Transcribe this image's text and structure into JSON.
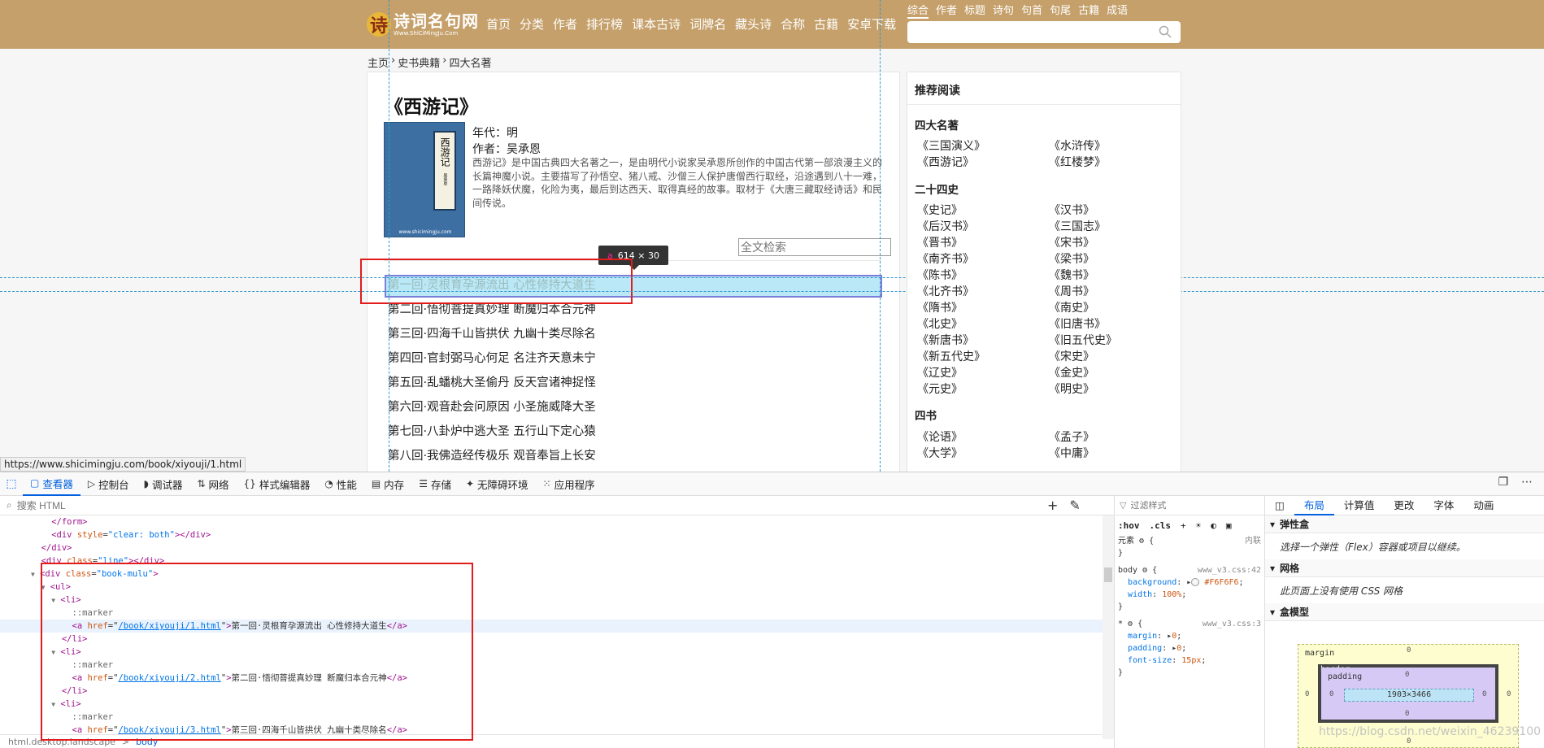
{
  "site": {
    "logo": {
      "title": "诗词名句网",
      "sub": "Www.ShiCiMingJu.Com"
    },
    "nav": [
      "首页",
      "分类",
      "作者",
      "排行榜",
      "课本古诗",
      "词牌名",
      "藏头诗",
      "合称",
      "古籍",
      "安卓下载"
    ],
    "search_tabs": [
      "综合",
      "作者",
      "标题",
      "诗句",
      "句首",
      "句尾",
      "古籍",
      "成语"
    ],
    "breadcrumb": [
      "主页",
      "›",
      "史书典籍",
      "›",
      "四大名著"
    ],
    "book": {
      "title": "《西游记》",
      "cover_text": "西游记",
      "cover_small": "吴承恩",
      "cover_url": "www.shicimingju.com",
      "era": "年代：明",
      "author": "作者：吴承恩",
      "desc": "西游记》是中国古典四大名著之一，是由明代小说家吴承恩所创作的中国古代第一部浪漫主义的长篇神魔小说。主要描写了孙悟空、猪八戒、沙僧三人保护唐僧西行取经，沿途遇到八十一难，一路降妖伏魔，化险为夷，最后到达西天、取得真经的故事。取材于《大唐三藏取经诗话》和民间传说。"
    },
    "fulltext_placeholder": "全文检索",
    "chapters": [
      "第一回·灵根育孕源流出 心性修持大道生",
      "第二回·悟彻菩提真妙理 断魔归本合元神",
      "第三回·四海千山皆拱伏 九幽十类尽除名",
      "第四回·官封弼马心何足 名注齐天意未宁",
      "第五回·乱蟠桃大圣偷丹 反天宫诸神捉怪",
      "第六回·观音赴会问原因 小圣施威降大圣",
      "第七回·八卦炉中逃大圣 五行山下定心猿",
      "第八回·我佛造经传极乐 观音奉旨上长安"
    ],
    "tooltip": {
      "tag": "a",
      "size": "614 × 30"
    },
    "sidebar": {
      "title": "推荐阅读",
      "cat1": "四大名著",
      "books1": [
        "《三国演义》",
        "《水浒传》",
        "《西游记》",
        "《红楼梦》"
      ],
      "cat2": "二十四史",
      "books2": [
        "《史记》",
        "《汉书》",
        "《后汉书》",
        "《三国志》",
        "《晋书》",
        "《宋书》",
        "《南齐书》",
        "《梁书》",
        "《陈书》",
        "《魏书》",
        "《北齐书》",
        "《周书》",
        "《隋书》",
        "《南史》",
        "《北史》",
        "《旧唐书》",
        "《新唐书》",
        "《旧五代史》",
        "《新五代史》",
        "《宋史》",
        "《辽史》",
        "《金史》",
        "《元史》",
        "《明史》"
      ],
      "cat3": "四书",
      "books3": [
        "《论语》",
        "《孟子》",
        "《大学》",
        "《中庸》"
      ]
    },
    "status_url": "https://www.shicimingju.com/book/xiyouji/1.html"
  },
  "devtools": {
    "tabs": [
      "查看器",
      "控制台",
      "调试器",
      "网络",
      "样式编辑器",
      "性能",
      "内存",
      "存储",
      "无障碍环境",
      "应用程序"
    ],
    "search_placeholder": "搜索 HTML",
    "code": {
      "l1": "</form>",
      "l2_tag": "<div ",
      "l2_attr": "style",
      "l2_val": "\"clear: both\"",
      "l2_end": "></div>",
      "l3": "</div>",
      "l4_attr": "class",
      "l4_val": "\"line\"",
      "l5_attr": "class",
      "l5_val": "\"book-mulu\"",
      "ul": "<ul>",
      "li": "<li>",
      "li_end": "</li>",
      "marker": "::marker",
      "href1": "/book/xiyouji/1.html",
      "text1": "第一回·灵根育孕源流出 心性修持大道生",
      "href2": "/book/xiyouji/2.html",
      "text2": "第二回·悟彻菩提真妙理 断魔归本合元神",
      "href3": "/book/xiyouji/3.html",
      "text3": "第三回·四海千山皆拱伏 九幽十类尽除名"
    },
    "breadcrumb": [
      "html.desktop.landscape",
      ">",
      "body"
    ],
    "styles": {
      "filter_placeholder": "过滤样式",
      "hov": ":hov",
      "cls": ".cls",
      "element_label": "元素",
      "element_brace": "{",
      "inline": "内联",
      "close": "}",
      "rule1_sel": "body",
      "rule1_src": "www_v3.css:42",
      "rule1_p1": "background",
      "rule1_v1": "#F6F6F6",
      "rule1_p2": "width",
      "rule1_v2": "100%",
      "rule2_sel": "*",
      "rule2_src": "www_v3.css:3",
      "rule2_p1": "margin",
      "rule2_v1": "0",
      "rule2_p2": "padding",
      "rule2_v2": "0",
      "rule2_p3": "font-size",
      "rule2_v3": "15px"
    },
    "layout": {
      "tabs": [
        "布局",
        "计算值",
        "更改",
        "字体",
        "动画"
      ],
      "flex_title": "弹性盒",
      "flex_note": "选择一个弹性（Flex）容器或项目以继续。",
      "grid_title": "网格",
      "grid_note": "此页面上没有使用 CSS 网格",
      "box_title": "盒模型",
      "margin_label": "margin",
      "border_label": "border",
      "padding_label": "padding",
      "content_size": "1903×3466",
      "zero": "0"
    }
  },
  "watermark": "https://blog.csdn.net/weixin_46239100",
  "colors": {
    "header": "#c5a06b",
    "highlight": "#66ccee",
    "red_box": "#e21b1b",
    "accent": "#0060df"
  }
}
